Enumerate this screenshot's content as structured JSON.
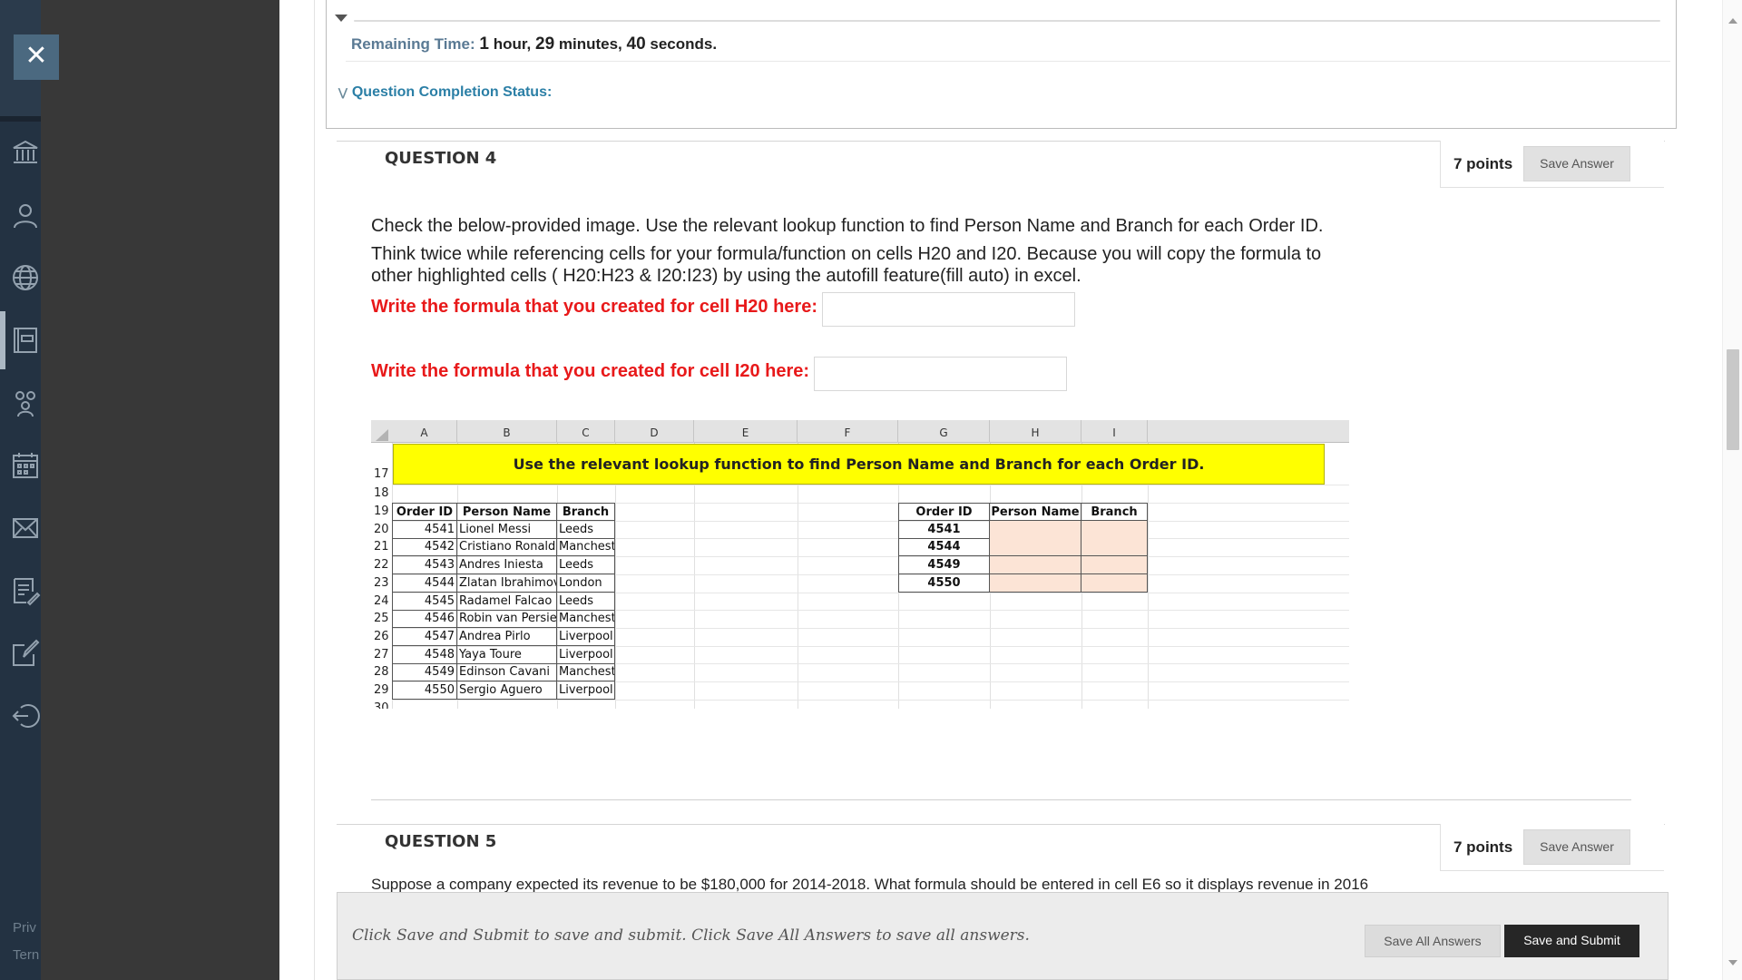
{
  "rail": {
    "close_glyph": "✕",
    "icons": [
      "institution-icon",
      "profile-icon",
      "globe-icon",
      "courses-icon",
      "groups-icon",
      "calendar-icon",
      "messages-icon",
      "grades-icon",
      "tools-icon",
      "signout-icon"
    ],
    "footer_privacy": "Priv",
    "footer_terms": "Tern"
  },
  "status": {
    "remaining_label": "Remaining Time:",
    "remaining_hours": "1",
    "remaining_hours_unit": "hour,",
    "remaining_minutes": "29",
    "remaining_minutes_unit": "minutes,",
    "remaining_seconds": "40",
    "remaining_seconds_unit": "seconds.",
    "completion_label": "Question Completion Status:"
  },
  "q4": {
    "title": "QUESTION 4",
    "points": "7 points",
    "save_label": "Save Answer",
    "text_line1": "Check the below-provided image. Use the relevant lookup function to find Person Name and Branch for each Order ID.",
    "text_line2": "Think twice while referencing cells for your formula/function on cells H20 and I20. Because you will copy the formula to",
    "text_line3": "other highlighted cells ( H20:H23 & I20:I23) by using the autofill feature(fill auto) in excel.",
    "prompt_h20": "Write the formula that you created for cell H20 here:",
    "prompt_i20": "Write the formula that you created for cell I20 here:",
    "answer_h20": "",
    "answer_i20": ""
  },
  "sheet": {
    "columns": [
      "A",
      "B",
      "C",
      "D",
      "E",
      "F",
      "G",
      "H",
      "I"
    ],
    "rows": [
      "17",
      "18",
      "19",
      "20",
      "21",
      "22",
      "23",
      "24",
      "25",
      "26",
      "27",
      "28",
      "29",
      "30"
    ],
    "banner": "Use the relevant lookup function to find Person Name and Branch for each Order ID.",
    "left_headers": [
      "Order ID",
      "Person Name",
      "Branch"
    ],
    "left_rows": [
      [
        "4541",
        "Lionel Messi",
        "Leeds"
      ],
      [
        "4542",
        "Cristiano Ronaldo",
        "Manchester"
      ],
      [
        "4543",
        "Andres Iniesta",
        "Leeds"
      ],
      [
        "4544",
        "Zlatan Ibrahimovic",
        "London"
      ],
      [
        "4545",
        "Radamel Falcao",
        "Leeds"
      ],
      [
        "4546",
        "Robin van Persie",
        "Manchester"
      ],
      [
        "4547",
        "Andrea Pirlo",
        "Liverpool"
      ],
      [
        "4548",
        "Yaya Toure",
        "Liverpool"
      ],
      [
        "4549",
        "Edinson Cavani",
        "Manchester"
      ],
      [
        "4550",
        "Sergio Aguero",
        "Liverpool"
      ]
    ],
    "right_headers": [
      "Order ID",
      "Person Name",
      "Branch"
    ],
    "right_ids": [
      "4541",
      "4544",
      "4549",
      "4550"
    ],
    "highlight_color": "#fce4d6",
    "banner_color": "#ffff00"
  },
  "q5": {
    "title": "QUESTION 5",
    "points": "7 points",
    "save_label": "Save Answer",
    "text": "Suppose a company expected its revenue to be $180,000 for 2014-2018. What formula should be entered in cell E6 so it displays revenue in 2016"
  },
  "savebar": {
    "note": "Click Save and Submit to save and submit. Click Save All Answers to save all answers.",
    "save_all": "Save All Answers",
    "save_submit": "Save and Submit"
  }
}
